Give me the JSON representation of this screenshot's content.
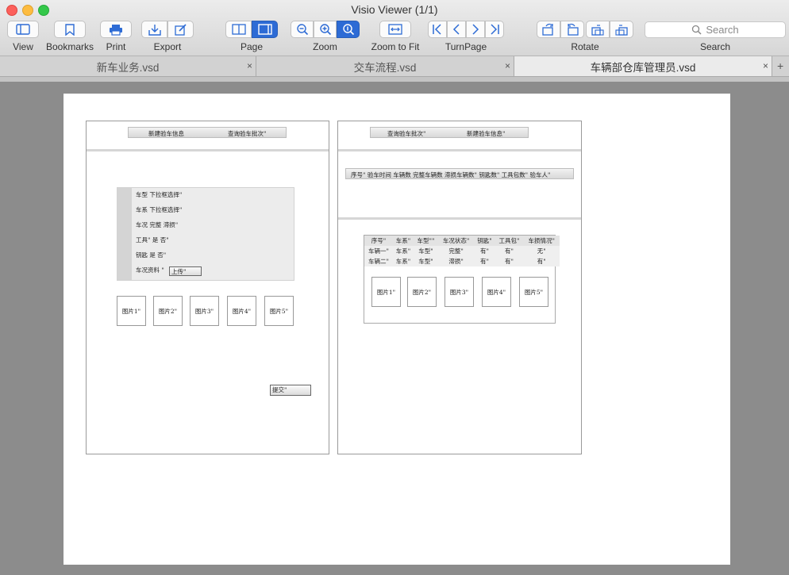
{
  "window": {
    "title": "Visio Viewer (1/1)"
  },
  "toolbar": {
    "view_label": "View",
    "bookmarks_label": "Bookmarks",
    "print_label": "Print",
    "export_label": "Export",
    "page_label": "Page",
    "zoom_label": "Zoom",
    "zoom_fit_label": "Zoom to Fit",
    "turnpage_label": "TurnPage",
    "rotate_label": "Rotate",
    "search_label": "Search",
    "search_placeholder": "Search",
    "accent_color": "#2d6bd5"
  },
  "tabs": [
    {
      "label": "新车业务.vsd",
      "close": "×"
    },
    {
      "label": "交车流程.vsd",
      "close": "×"
    },
    {
      "label": "车辆部仓库管理员.vsd",
      "close": "×"
    }
  ],
  "tab_add": "+",
  "left_panel": {
    "header_left": "新建验车信息",
    "header_right": "查询验车批次\"",
    "form": {
      "row1": "车型 下拉框选择\"",
      "row2": "车系 下拉框选择\"",
      "row3": "车况 完整 滞损\"",
      "row4": "工具\" 是 否\"",
      "row5": "钥匙 是 否\"",
      "row6": "车况资料 \"",
      "upload_button": "上传\""
    },
    "images": [
      "图片1\"",
      "图片2\"",
      "图片3\"",
      "图片4\"",
      "图片5\""
    ],
    "submit_button": "提交\""
  },
  "right_panel": {
    "header_left": "查询验车批次\"",
    "header_right": "新建验车信息\"",
    "batch_header": "序号\"  验车时间  车辆数 完整车辆数 滞损车辆数\" 钥匙数\" 工具包数\" 验车人\"",
    "table": {
      "columns": [
        "序号\"",
        "车系\"",
        "车型\"\"",
        "车况状态\"",
        "钥匙\"",
        "工具包\"",
        "车损情况\""
      ],
      "rows": [
        [
          "车辆一\"",
          "车系\"",
          "车型\"",
          "完整\"",
          "有\"",
          "有\"",
          "无\""
        ],
        [
          "车辆二\"",
          "车系\"",
          "车型\"",
          "滞损\"",
          "有\"",
          "有\"",
          "有\""
        ]
      ]
    },
    "images": [
      "图片1\"",
      "图片2\"",
      "图片3\"",
      "图片4\"",
      "图片5\""
    ]
  }
}
